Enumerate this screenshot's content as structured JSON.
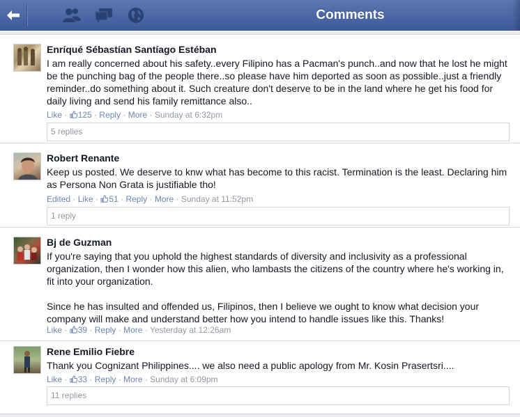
{
  "header": {
    "title": "Comments",
    "back_icon": "back-arrow-icon",
    "icons": [
      "friends-icon",
      "messages-icon",
      "globe-icon"
    ]
  },
  "comments": [
    {
      "author": "Enríqué Sébastían Santíago Estéban",
      "text": "I am really concerned about his safety..every Filipino has a Pacman's punch..and now that he lost he might be the punching bag of the people there..so please have him deported as soon as possible..just a friendly reminder..do something about it. Such creature don't deserve to be in the land where he get his food for daily living and send his family remittance also..",
      "like": "Like",
      "likes": "125",
      "reply": "Reply",
      "more": "More",
      "time": "Sunday at 6:32pm",
      "replies": "5 replies"
    },
    {
      "author": "Robert Renante",
      "text": "Keep us posted. We deserve to knw what has become to this racist. Termination is the least. Declaring him as Persona Non Grata is justifiable tho!",
      "edited": "Edited",
      "like": "Like",
      "likes": "51",
      "reply": "Reply",
      "more": "More",
      "time": "Sunday at 11:52pm",
      "replies": "1 reply"
    },
    {
      "author": "Bj de Guzman",
      "text": "If you're saying that you uphold the highest standards of diversity and inclusivity as a professional organization, then I wonder how this alien, who lambasts the citizens of the country where he's working in, fit into your organization.\n\nSince he has insulted and offended us, Filipinos, then I believe we ought to know what decision your company will make and understand better how you intend to handle issues like this. Thanks!",
      "like": "Like",
      "likes": "39",
      "reply": "Reply",
      "more": "More",
      "time": "Yesterday at 12:26am"
    },
    {
      "author": "Rene Emilio Fiebre",
      "text": "Thank you Cognizant Philippines.... we also need a public apology from Mr. Kosin Prasertsri....",
      "like": "Like",
      "likes": "33",
      "reply": "Reply",
      "more": "More",
      "time": "Sunday at 6:09pm",
      "replies": "11 replies"
    }
  ],
  "colors": {
    "header_top": "#5b77b3",
    "header_bottom": "#3e5b9a",
    "link": "#6d84b4",
    "meta": "#9197a3",
    "border": "#d3d6db"
  }
}
